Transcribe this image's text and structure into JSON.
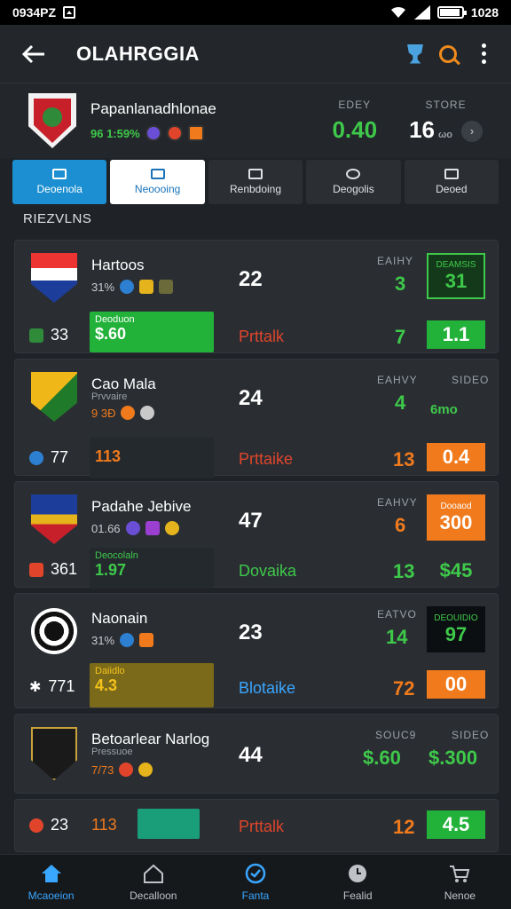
{
  "status": {
    "time_left": "0934PZ",
    "time_right": "1028"
  },
  "appbar": {
    "title": "OLAHRGGIA"
  },
  "league": {
    "name": "Papanlanadhlonae",
    "sub_text": "96 1:59%",
    "stat1_label": "EDEY",
    "stat1_value": "0.40",
    "stat2_label": "STORE",
    "stat2_value": "16",
    "stat2_unit": "ωo"
  },
  "tabs": [
    "Deoenola",
    "Neoooing",
    "Renbdoing",
    "Deogolis",
    "Deoed"
  ],
  "section_label": "RIEZVLNS",
  "cards": [
    {
      "team": "Hartoos",
      "sub": "31%",
      "score": "22",
      "col1_label": "EAIHY",
      "col1_value": "3",
      "box_label": "DEAMSIS",
      "box_value": "31",
      "bottom_left": "33",
      "chip_label": "Deoduon",
      "chip_value": "$.60",
      "market": "Prttalk",
      "right_value": "7",
      "odds": "1.1"
    },
    {
      "team": "Cao Mala",
      "sub": "9 3Ð",
      "sub_top": "Prvvaire",
      "score": "24",
      "col1_label": "EAHVY",
      "col1_value": "4",
      "col2_label": "SIDEO",
      "col2_value": "6mo",
      "bottom_left": "77",
      "chip_label": "",
      "chip_value": "113",
      "market": "Prttaike",
      "right_value": "13",
      "odds": "0.4"
    },
    {
      "team": "Padahe Jebive",
      "sub": "01.66",
      "score": "47",
      "col1_label": "EAHVY",
      "col1_value": "6",
      "box_label": "Dooaod",
      "box_value": "300",
      "bottom_left": "361",
      "chip_label": "Deocolaln",
      "chip_value": "1.97",
      "market": "Dovaika",
      "right_value": "13",
      "odds": "$45"
    },
    {
      "team": "Naonain",
      "sub": "31%",
      "score": "23",
      "col1_label": "EATVO",
      "col1_value": "14",
      "box_label": "DEOUIDIO",
      "box_value": "97",
      "bottom_left": "771",
      "chip_label": "Daiidlo",
      "chip_value": "4.3",
      "market": "Blotaike",
      "right_value": "72",
      "odds": "00"
    },
    {
      "team": "Betoarlear Narlog",
      "sub": "7/73",
      "sub_top": "Pressuoe",
      "score": "44",
      "col1_label": "SOUC9",
      "col1_value": "$.60",
      "col2_label": "SIDEO",
      "col2_value": "$.300"
    },
    {
      "bottom_left": "23",
      "chip_value": "113",
      "market": "Prttalk",
      "right_value": "12",
      "odds": "4.5"
    }
  ],
  "nav": [
    "Mcaoeion",
    "Decalloon",
    "Fanta",
    "Fealid",
    "Nenoe"
  ],
  "colors": {
    "green": "#3ec94a",
    "orange": "#f07a1c",
    "blue": "#39a6ff",
    "red": "#e0452b"
  }
}
